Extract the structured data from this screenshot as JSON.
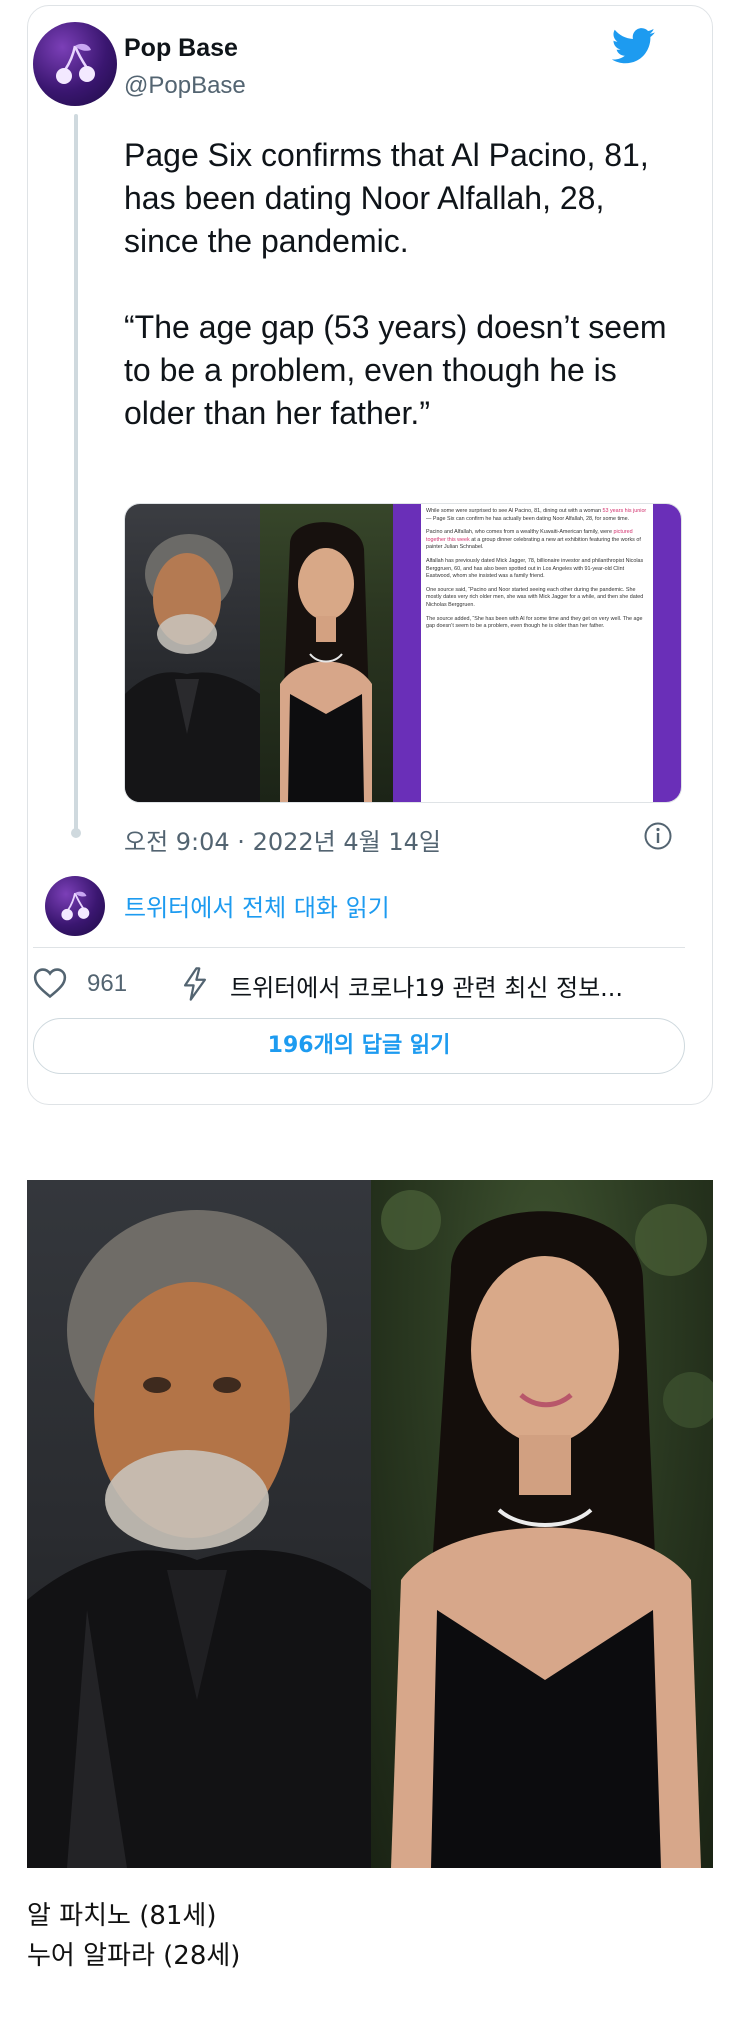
{
  "tweet": {
    "author_name": "Pop Base",
    "author_handle": "@PopBase",
    "text": "Page Six confirms that Al Pacino, 81, has been dating Noor Alfallah, 28, since the pandemic.\n\n“The age gap (53 years) doesn’t seem to be a problem, even though he is older than her father.”",
    "timestamp": "오전 9:04 · 2022년 4월 14일",
    "read_conversation": "트위터에서 전체 대화 읽기",
    "like_count": "961",
    "covid_info": "트위터에서 코로나19 관련 최신 정보...",
    "replies_button": "196개의 답글 읽기"
  },
  "article_snippet": {
    "p1_a": "While some were surprised to see Al Pacino, 81, dining out with a woman ",
    "p1_hl": "53 years his junior",
    "p1_b": " — Page Six can confirm he has actually been dating Noor Alfallah, 28, for some time.",
    "p2_a": "Pacino and Alfallah, who comes from a wealthy Kuwaiti-American family, were ",
    "p2_hl": "pictured together this week",
    "p2_b": " at a group dinner celebrating a new art exhibition featuring the works of painter Julian Schnabel.",
    "p3": "Alfallah has previously dated Mick Jagger, 78, billionaire investor and philanthropist Nicolas Berggruen, 60, and has also been spotted out in Los Angeles with 91-year-old Clint Eastwood, whom she insisted was a family friend.",
    "p4": "One source said, “Pacino and Noor started seeing each other during the pandemic. She mostly dates very rich older men, she was with Mick Jagger for a while, and then she dated Nicholas Berggruen.",
    "p5": "The source added, “She has been with Al for some time and they get on very well. The age gap doesn’t seem to be a problem, even though he is older than her father."
  },
  "caption": {
    "line1": "알 파치노 (81세)",
    "line2": "누어 알파라 (28세)"
  },
  "colors": {
    "twitter_blue": "#1d9bf0",
    "secondary_text": "#536471",
    "avatar_purple": "#3a1670",
    "article_purple": "#6a2fb8"
  },
  "icons": [
    "twitter-bird-icon",
    "info-icon",
    "heart-icon",
    "lightning-icon",
    "cherry-logo-icon"
  ]
}
